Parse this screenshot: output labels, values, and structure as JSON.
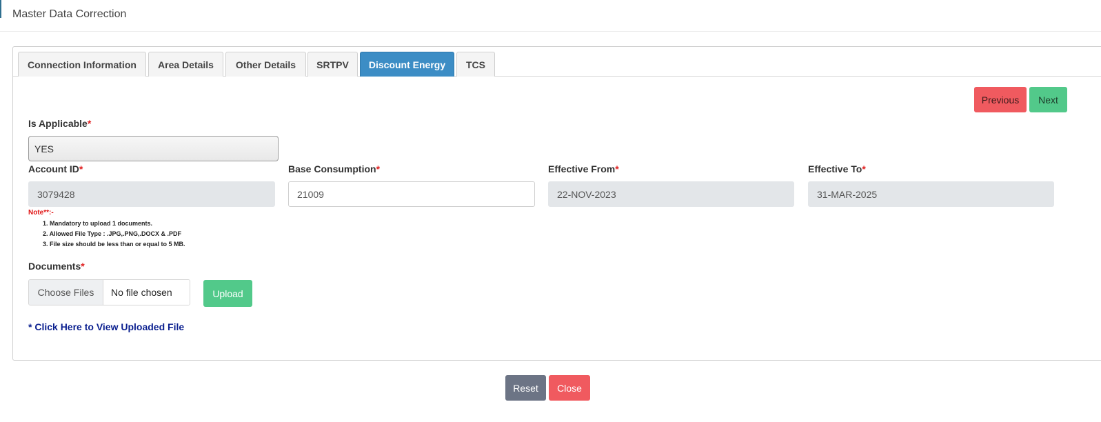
{
  "header": {
    "title": "Master Data Correction"
  },
  "tabs": [
    {
      "label": "Connection Information",
      "active": false
    },
    {
      "label": "Area Details",
      "active": false
    },
    {
      "label": "Other Details",
      "active": false
    },
    {
      "label": "SRTPV",
      "active": false
    },
    {
      "label": "Discount Energy",
      "active": true
    },
    {
      "label": "TCS",
      "active": false
    }
  ],
  "nav": {
    "previous": "Previous",
    "next": "Next"
  },
  "form": {
    "is_applicable": {
      "label": "Is Applicable",
      "value": "YES"
    },
    "account_id": {
      "label": "Account ID",
      "value": "3079428"
    },
    "base_consumption": {
      "label": "Base Consumption",
      "value": "21009"
    },
    "effective_from": {
      "label": "Effective From",
      "value": "22-NOV-2023"
    },
    "effective_to": {
      "label": "Effective To",
      "value": "31-MAR-2025"
    },
    "required_mark": "*"
  },
  "note": {
    "title": "Note**:-",
    "items": [
      "1. Mandatory to upload 1 documents.",
      "2. Allowed File Type : .JPG,.PNG,.DOCX & .PDF",
      "3. File size should be less than or equal to 5 MB."
    ]
  },
  "documents": {
    "label": "Documents",
    "choose": "Choose Files",
    "status": "No file chosen",
    "upload": "Upload",
    "view_link": "* Click Here to View Uploaded File"
  },
  "footer": {
    "reset": "Reset",
    "close": "Close"
  },
  "colors": {
    "active_tab": "#3c8dc5",
    "danger": "#f05a5f",
    "success": "#52c98a",
    "reset": "#6c7485",
    "link": "#0a1f8f"
  }
}
